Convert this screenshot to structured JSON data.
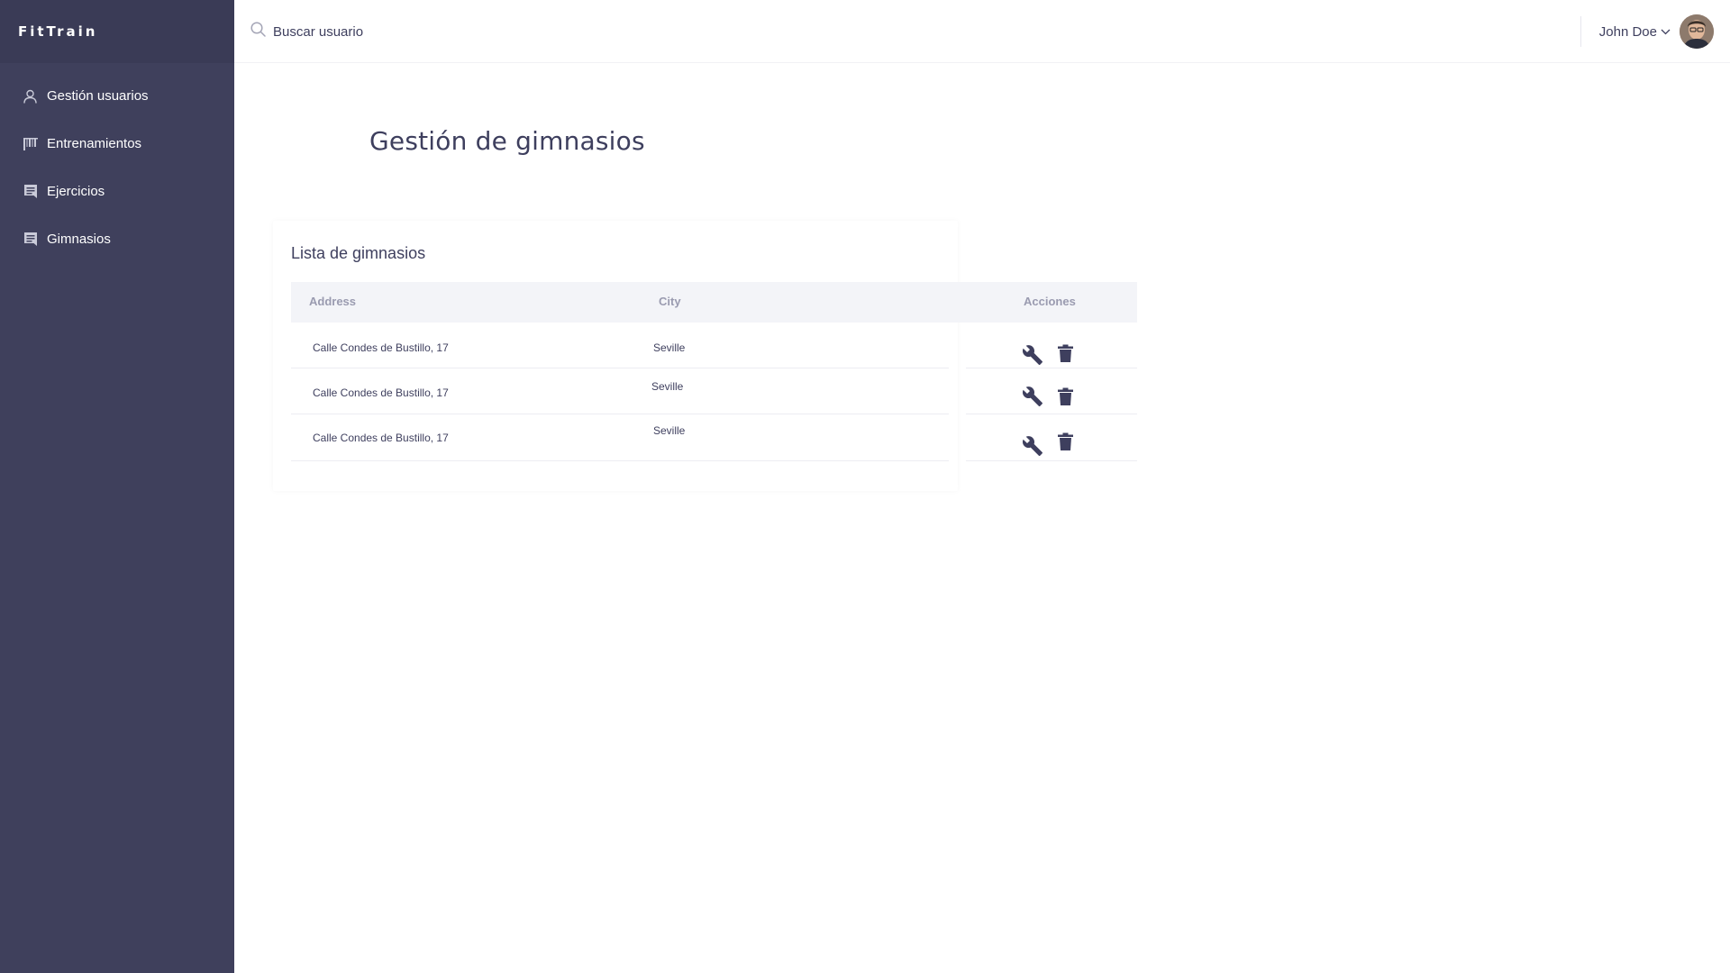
{
  "brand": "FitTrain",
  "sidebar": {
    "items": [
      {
        "label": "Gestión usuarios",
        "icon": "user-icon"
      },
      {
        "label": "Entrenamientos",
        "icon": "barcode-icon"
      },
      {
        "label": "Ejercicios",
        "icon": "list-icon"
      },
      {
        "label": "Gimnasios",
        "icon": "list-icon"
      }
    ]
  },
  "search": {
    "placeholder": "Buscar usuario"
  },
  "user": {
    "name": "John Doe"
  },
  "page": {
    "title": "Gestión de gimnasios"
  },
  "card": {
    "title": "Lista de gimnasios"
  },
  "table": {
    "headers": {
      "address": "Address",
      "city": "City",
      "actions": "Acciones"
    },
    "rows": [
      {
        "address": "Calle Condes de Bustillo, 17",
        "city": "Seville"
      },
      {
        "address": "Calle Condes de Bustillo, 17",
        "city": "Seville"
      },
      {
        "address": "Calle Condes de Bustillo, 17",
        "city": "Seville"
      }
    ]
  },
  "colors": {
    "sidebar": "#3f405c",
    "accent": "#3e3f5e"
  }
}
